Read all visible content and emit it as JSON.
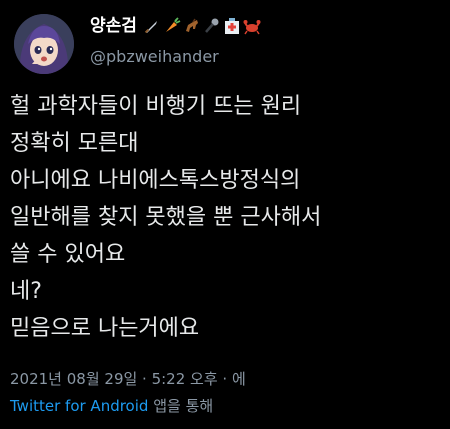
{
  "tweet": {
    "display_name": "양손검",
    "name_emojis": [
      "dagger-emoji",
      "carrot-emoji",
      "horse-emoji",
      "microphone-emoji",
      "hospital-emoji",
      "crab-emoji"
    ],
    "handle": "@pbzweihander",
    "body_lines": [
      "헐 과학자들이 비행기 뜨는 원리",
      "정확히 모른대",
      "아니에요 나비에스톡스방정식의",
      "일반해를 찾지 못했을 뿐 근사해서",
      "쓸 수 있어요",
      "네?",
      "믿음으로 나는거에요"
    ],
    "meta": "2021년 08월 29일 · 5:22 오후 · 에",
    "source_link": "Twitter for Android",
    "source_suffix": " 앱을 통해"
  },
  "colors": {
    "background": "#000000",
    "text": "#e7e9ea",
    "muted": "#8b98a5",
    "link": "#1d9bf0"
  }
}
